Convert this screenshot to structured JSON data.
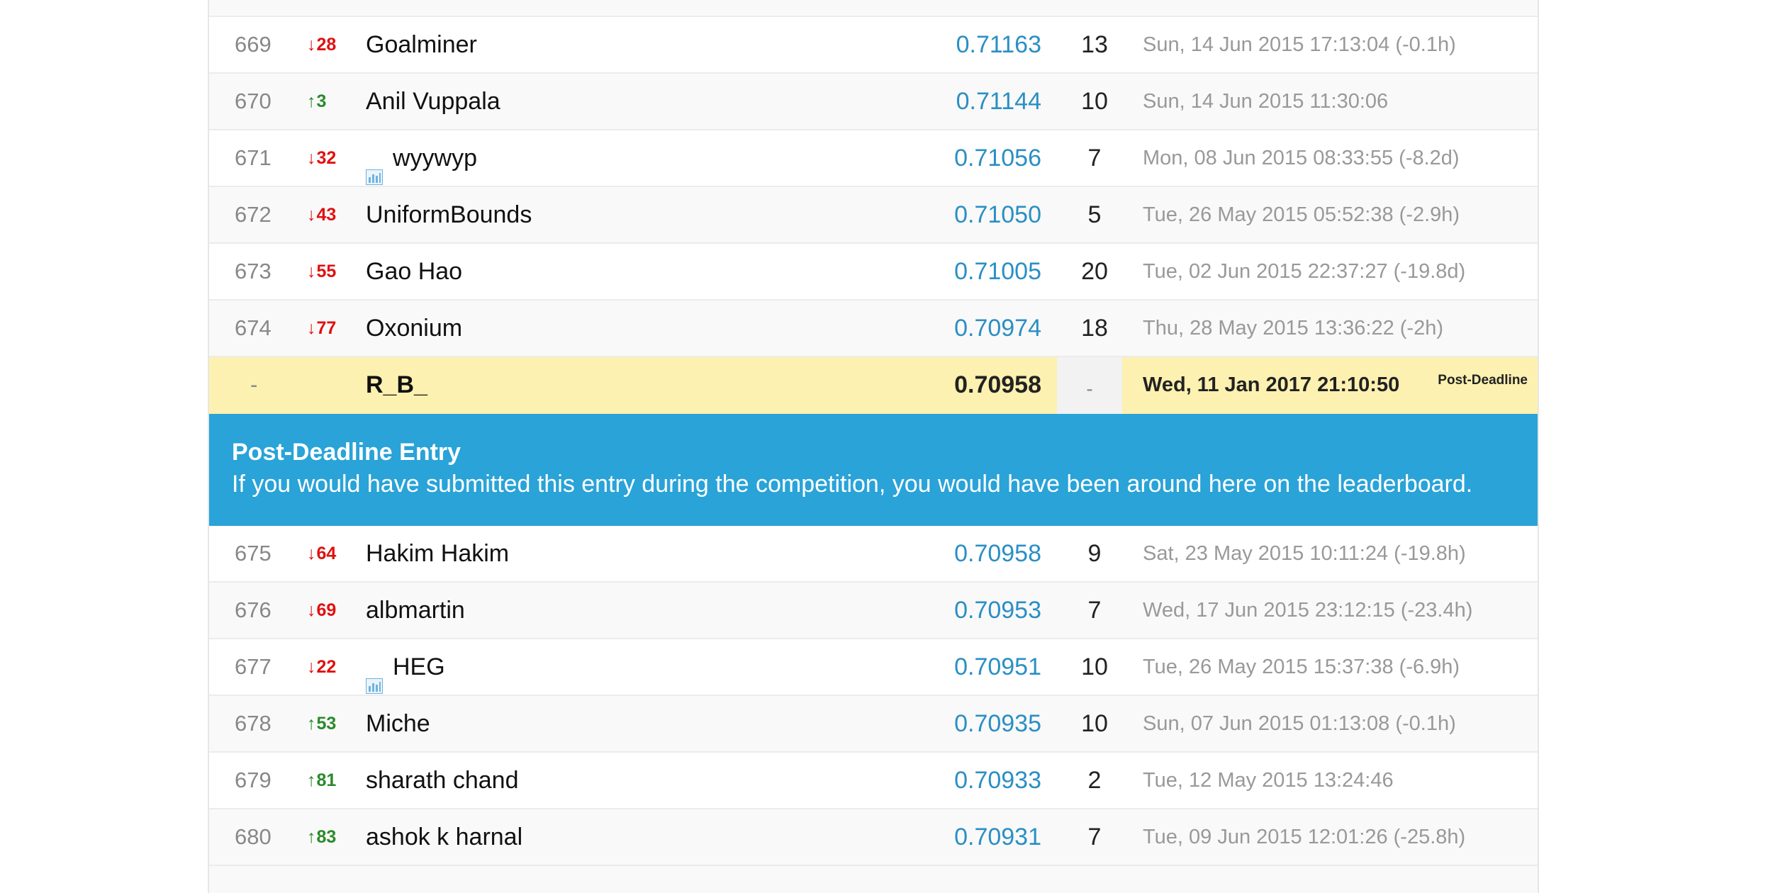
{
  "rows_before": [
    {
      "rank": "669",
      "arrow": "↓",
      "change": "28",
      "dir": "down",
      "team": "Goalminer",
      "has_icon": false,
      "score": "0.71163",
      "entries": "13",
      "last": "Sun, 14 Jun 2015 17:13:04 (-0.1h)"
    },
    {
      "rank": "670",
      "arrow": "↑",
      "change": "3",
      "dir": "up",
      "team": "Anil Vuppala",
      "has_icon": false,
      "score": "0.71144",
      "entries": "10",
      "last": "Sun, 14 Jun 2015 11:30:06"
    },
    {
      "rank": "671",
      "arrow": "↓",
      "change": "32",
      "dir": "down",
      "team": "wyywyp",
      "has_icon": true,
      "score": "0.71056",
      "entries": "7",
      "last": "Mon, 08 Jun 2015 08:33:55 (-8.2d)"
    },
    {
      "rank": "672",
      "arrow": "↓",
      "change": "43",
      "dir": "down",
      "team": "UniformBounds",
      "has_icon": false,
      "score": "0.71050",
      "entries": "5",
      "last": "Tue, 26 May 2015 05:52:38 (-2.9h)"
    },
    {
      "rank": "673",
      "arrow": "↓",
      "change": "55",
      "dir": "down",
      "team": "Gao Hao",
      "has_icon": false,
      "score": "0.71005",
      "entries": "20",
      "last": "Tue, 02 Jun 2015 22:37:27 (-19.8d)"
    },
    {
      "rank": "674",
      "arrow": "↓",
      "change": "77",
      "dir": "down",
      "team": "Oxonium",
      "has_icon": false,
      "score": "0.70974",
      "entries": "18",
      "last": "Thu, 28 May 2015 13:36:22 (-2h)"
    }
  ],
  "post_deadline_row": {
    "rank": "-",
    "team": "R_B_",
    "score": "0.70958",
    "entries": "-",
    "last": "Wed, 11 Jan 2017 21:10:50",
    "tag": "Post-Deadline"
  },
  "notice": {
    "title": "Post-Deadline Entry",
    "text": "If you would have submitted this entry during the competition, you would have been around here on the leaderboard."
  },
  "rows_after": [
    {
      "rank": "675",
      "arrow": "↓",
      "change": "64",
      "dir": "down",
      "team": "Hakim Hakim",
      "has_icon": false,
      "score": "0.70958",
      "entries": "9",
      "last": "Sat, 23 May 2015 10:11:24 (-19.8h)"
    },
    {
      "rank": "676",
      "arrow": "↓",
      "change": "69",
      "dir": "down",
      "team": "albmartin",
      "has_icon": false,
      "score": "0.70953",
      "entries": "7",
      "last": "Wed, 17 Jun 2015 23:12:15 (-23.4h)"
    },
    {
      "rank": "677",
      "arrow": "↓",
      "change": "22",
      "dir": "down",
      "team": "HEG",
      "has_icon": true,
      "score": "0.70951",
      "entries": "10",
      "last": "Tue, 26 May 2015 15:37:38 (-6.9h)"
    },
    {
      "rank": "678",
      "arrow": "↑",
      "change": "53",
      "dir": "up",
      "team": "Miche",
      "has_icon": false,
      "score": "0.70935",
      "entries": "10",
      "last": "Sun, 07 Jun 2015 01:13:08 (-0.1h)"
    },
    {
      "rank": "679",
      "arrow": "↑",
      "change": "81",
      "dir": "up",
      "team": "sharath chand",
      "has_icon": false,
      "score": "0.70933",
      "entries": "2",
      "last": "Tue, 12 May 2015 13:24:46"
    },
    {
      "rank": "680",
      "arrow": "↑",
      "change": "83",
      "dir": "up",
      "team": "ashok k harnal",
      "has_icon": false,
      "score": "0.70931",
      "entries": "7",
      "last": "Tue, 09 Jun 2015 12:01:26 (-25.8h)"
    }
  ],
  "colors": {
    "score_link": "#2a8fc4",
    "rank_down": "#e01010",
    "rank_up": "#2a8a2a",
    "highlight_row": "#fcf1b0",
    "notice_bg": "#29a3d8"
  },
  "icons": {
    "team_badge": "bar-chart-icon",
    "arrow_down": "arrow-down-icon",
    "arrow_up": "arrow-up-icon"
  }
}
